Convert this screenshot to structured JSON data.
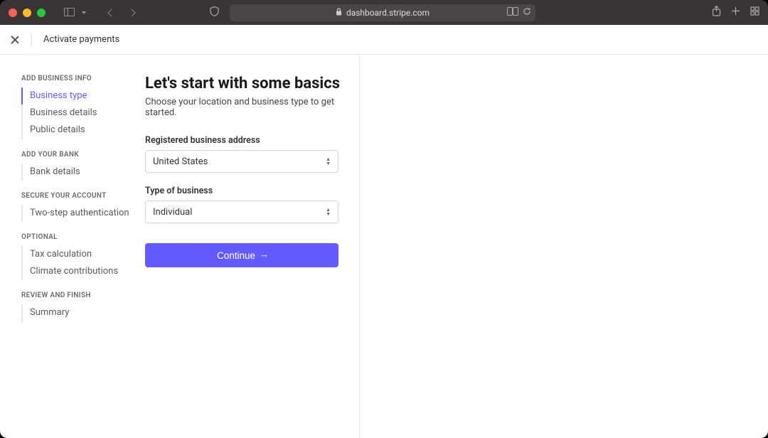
{
  "browser": {
    "url": "dashboard.stripe.com"
  },
  "header": {
    "title": "Activate payments"
  },
  "sidebar": {
    "groups": [
      {
        "heading": "ADD BUSINESS INFO",
        "items": [
          {
            "label": "Business type",
            "active": true
          },
          {
            "label": "Business details",
            "active": false
          },
          {
            "label": "Public details",
            "active": false
          }
        ]
      },
      {
        "heading": "ADD YOUR BANK",
        "items": [
          {
            "label": "Bank details",
            "active": false
          }
        ]
      },
      {
        "heading": "SECURE YOUR ACCOUNT",
        "items": [
          {
            "label": "Two-step authentication",
            "active": false
          }
        ]
      },
      {
        "heading": "OPTIONAL",
        "items": [
          {
            "label": "Tax calculation",
            "active": false
          },
          {
            "label": "Climate contributions",
            "active": false
          }
        ]
      },
      {
        "heading": "REVIEW AND FINISH",
        "items": [
          {
            "label": "Summary",
            "active": false
          }
        ]
      }
    ]
  },
  "main": {
    "heading": "Let's start with some basics",
    "subtext": "Choose your location and business type to get started.",
    "fields": {
      "address": {
        "label": "Registered business address",
        "value": "United States"
      },
      "bizType": {
        "label": "Type of business",
        "value": "Individual"
      }
    },
    "cta": "Continue"
  }
}
